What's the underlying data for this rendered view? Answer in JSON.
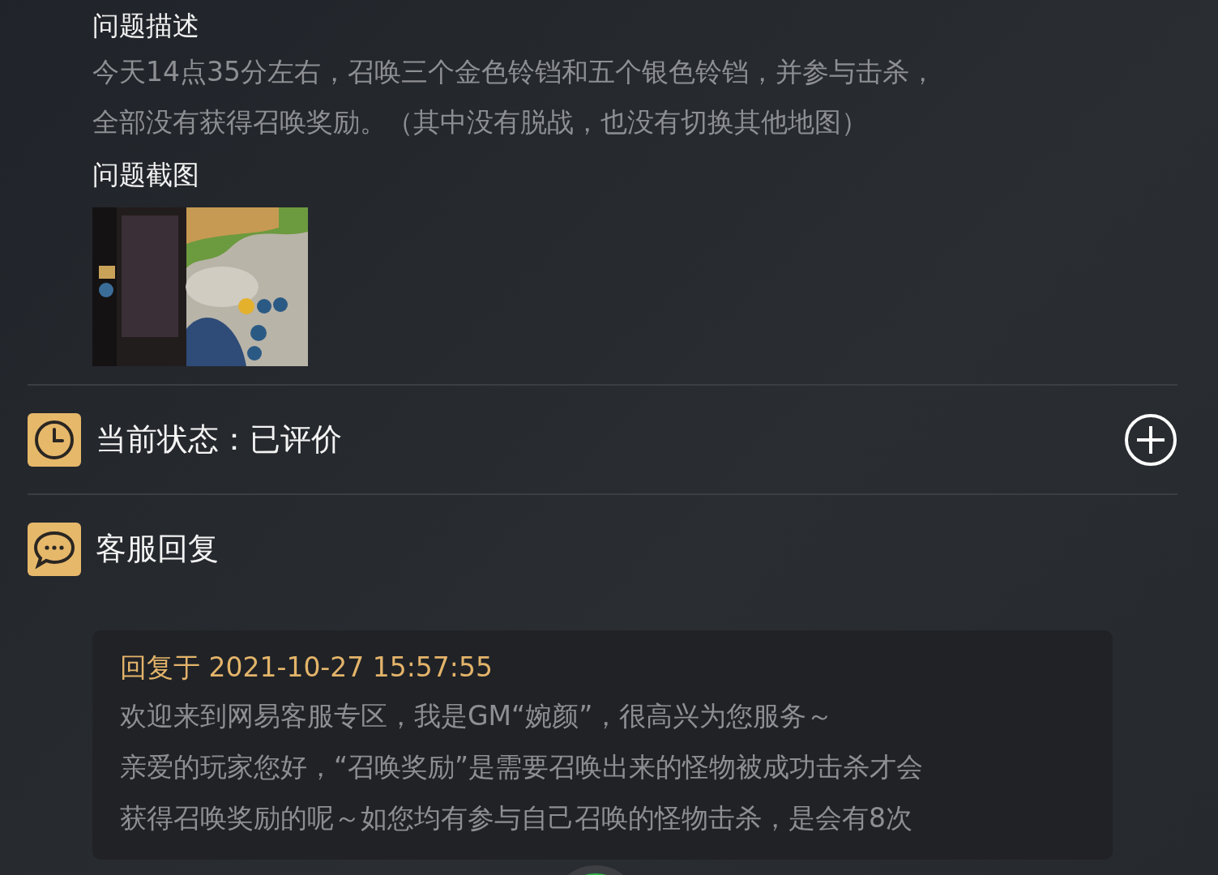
{
  "description": {
    "heading": "问题描述",
    "lines": [
      "今天14点35分左右，召唤三个金色铃铛和五个银色铃铛，并参与击杀，",
      "全部没有获得召唤奖励。（其中没有脱战，也没有切换其他地图）"
    ]
  },
  "screenshot": {
    "heading": "问题截图"
  },
  "status": {
    "label": "当前状态：已评价",
    "expanded": false
  },
  "reply_section": {
    "heading": "客服回复"
  },
  "reply": {
    "time": "回复于 2021-10-27 15:57:55",
    "lines": [
      "欢迎来到网易客服专区，我是GM“婉颜”，很高兴为您服务～",
      "亲爱的玩家您好，“召唤奖励”是需要召唤出来的怪物被成功击杀才会",
      "获得召唤奖励的呢～如您均有参与自己召唤的怪物击杀，是会有8次"
    ]
  }
}
